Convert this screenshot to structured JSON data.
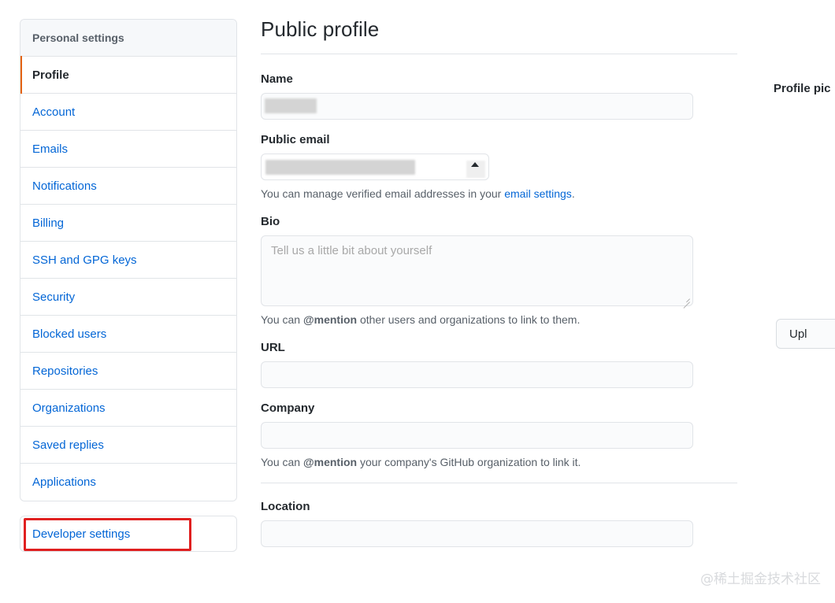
{
  "sidebar": {
    "header": "Personal settings",
    "items": [
      {
        "label": "Profile",
        "active": true
      },
      {
        "label": "Account",
        "active": false
      },
      {
        "label": "Emails",
        "active": false
      },
      {
        "label": "Notifications",
        "active": false
      },
      {
        "label": "Billing",
        "active": false
      },
      {
        "label": "SSH and GPG keys",
        "active": false
      },
      {
        "label": "Security",
        "active": false
      },
      {
        "label": "Blocked users",
        "active": false
      },
      {
        "label": "Repositories",
        "active": false
      },
      {
        "label": "Organizations",
        "active": false
      },
      {
        "label": "Saved replies",
        "active": false
      },
      {
        "label": "Applications",
        "active": false
      }
    ],
    "developer_settings": "Developer settings",
    "annotation_color": "#e02020",
    "active_indicator_color": "#e36209",
    "link_color": "#0366d6"
  },
  "main": {
    "title": "Public profile",
    "name": {
      "label": "Name",
      "value": "",
      "redacted": true
    },
    "public_email": {
      "label": "Public email",
      "selected_value": "",
      "redacted": true,
      "help_prefix": "You can manage verified email addresses in your ",
      "help_link": "email settings",
      "help_suffix": "."
    },
    "bio": {
      "label": "Bio",
      "placeholder": "Tell us a little bit about yourself",
      "value": "",
      "help_prefix": "You can ",
      "help_mention": "@mention",
      "help_suffix": " other users and organizations to link to them."
    },
    "url": {
      "label": "URL",
      "value": "",
      "placeholder": ""
    },
    "company": {
      "label": "Company",
      "value": "",
      "placeholder": "",
      "help_prefix": "You can ",
      "help_mention": "@mention",
      "help_suffix": " your company's GitHub organization to link it."
    },
    "location": {
      "label": "Location",
      "value": "",
      "placeholder": ""
    }
  },
  "right": {
    "profile_picture_title": "Profile pic",
    "upload_button": "Upl"
  },
  "watermark": "@稀土掘金技术社区"
}
